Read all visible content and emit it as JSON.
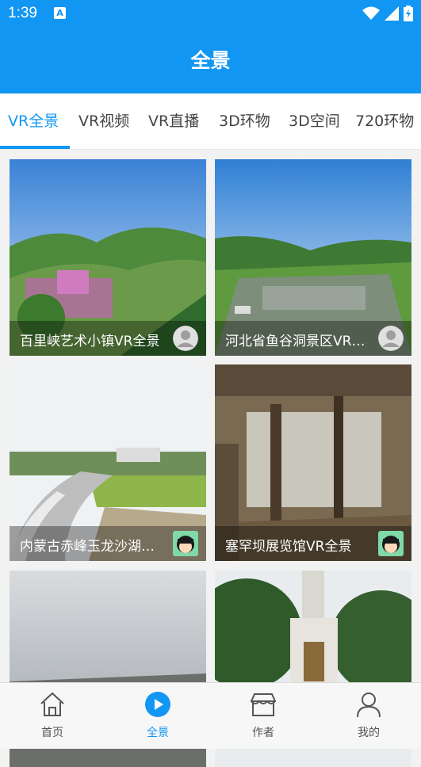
{
  "status": {
    "time": "1:39"
  },
  "header": {
    "title": "全景"
  },
  "tabs": [
    {
      "label": "VR全景"
    },
    {
      "label": "VR视频"
    },
    {
      "label": "VR直播"
    },
    {
      "label": "3D环物"
    },
    {
      "label": "3D空间"
    },
    {
      "label": "720环物"
    }
  ],
  "cards": [
    {
      "title": "百里峡艺术小镇VR全景",
      "avatar": "default-avatar-icon"
    },
    {
      "title": "河北省鱼谷洞景区VR全景",
      "avatar": "default-avatar-icon"
    },
    {
      "title": "内蒙古赤峰玉龙沙湖全景",
      "avatar": "cartoon-girl-avatar"
    },
    {
      "title": "塞罕坝展览馆VR全景",
      "avatar": "cartoon-girl-avatar"
    },
    {
      "title": ""
    },
    {
      "title": ""
    }
  ],
  "nav": [
    {
      "label": "首页",
      "icon": "home-icon"
    },
    {
      "label": "全景",
      "icon": "play-circle-icon"
    },
    {
      "label": "作者",
      "icon": "shop-icon"
    },
    {
      "label": "我的",
      "icon": "user-icon"
    }
  ],
  "colors": {
    "accent": "#1296f3"
  }
}
